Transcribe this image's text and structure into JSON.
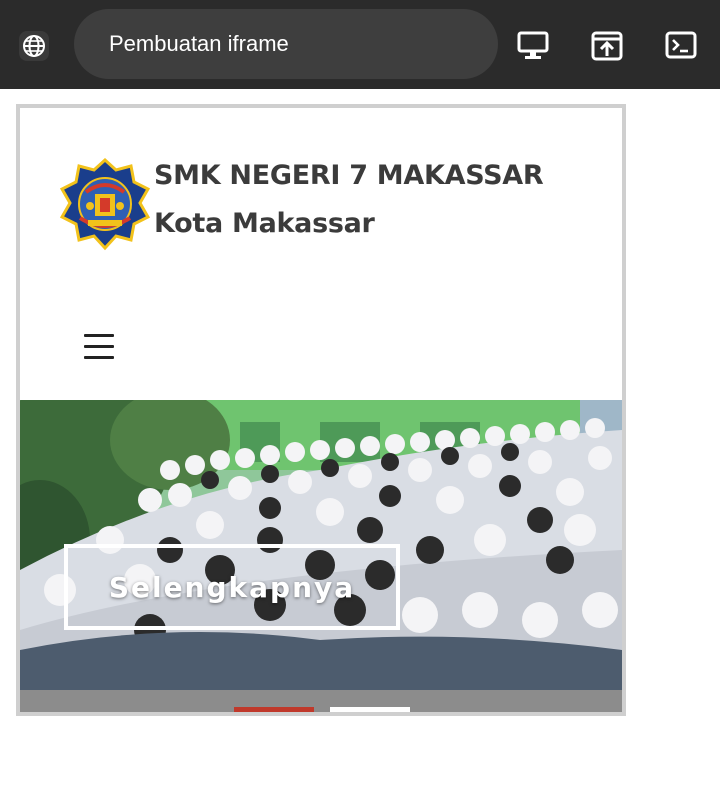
{
  "browser": {
    "address_text": "Pembuatan iframe",
    "icons": {
      "site_info": "globe-icon",
      "desktop_mode": "desktop-icon",
      "open_external": "open-in-new-icon",
      "console": "terminal-icon"
    }
  },
  "site": {
    "school_name": "SMK NEGERI 7 MAKASSAR",
    "city": "Kota Makassar",
    "menu_icon": "hamburger-icon",
    "hero": {
      "cta_label": "Selengkapnya"
    }
  },
  "colors": {
    "topbar": "#2b2b2b",
    "address_pill": "#3e3e3e",
    "heading_text": "#3b3b3b",
    "slide_indicator_active": "#c0392b"
  }
}
